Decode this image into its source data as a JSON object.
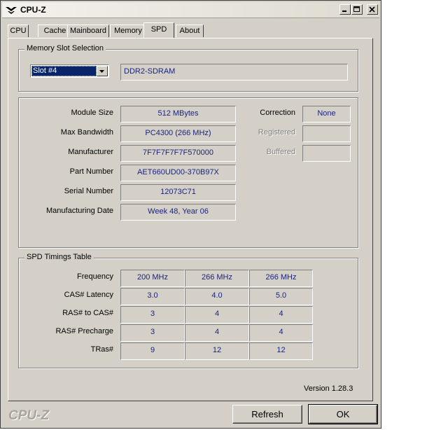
{
  "window": {
    "title": "CPU-Z"
  },
  "tabs": [
    {
      "label": "CPU",
      "active": false
    },
    {
      "label": "Cache",
      "active": false
    },
    {
      "label": "Mainboard",
      "active": false
    },
    {
      "label": "Memory",
      "active": false
    },
    {
      "label": "SPD",
      "active": true
    },
    {
      "label": "About",
      "active": false
    }
  ],
  "slot_selection": {
    "title": "Memory Slot Selection",
    "selected": "Slot #4",
    "memory_type": "DDR2-SDRAM"
  },
  "module": {
    "rows": [
      {
        "label": "Module Size",
        "value": "512 MBytes"
      },
      {
        "label": "Max Bandwidth",
        "value": "PC4300 (266 MHz)"
      },
      {
        "label": "Manufacturer",
        "value": "7F7F7F7F7F570000"
      },
      {
        "label": "Part Number",
        "value": "AET660UD00-370B97X"
      },
      {
        "label": "Serial Number",
        "value": "12073C71"
      },
      {
        "label": "Manufacturing Date",
        "value": "Week 48, Year 06"
      }
    ],
    "side": [
      {
        "label": "Correction",
        "value": "None",
        "enabled": true
      },
      {
        "label": "Registered",
        "value": "",
        "enabled": false
      },
      {
        "label": "Buffered",
        "value": "",
        "enabled": false
      }
    ]
  },
  "timings": {
    "title": "SPD Timings Table",
    "rows": [
      {
        "label": "Frequency",
        "values": [
          "200 MHz",
          "266 MHz",
          "266 MHz"
        ]
      },
      {
        "label": "CAS# Latency",
        "values": [
          "3.0",
          "4.0",
          "5.0"
        ]
      },
      {
        "label": "RAS# to CAS#",
        "values": [
          "3",
          "4",
          "4"
        ]
      },
      {
        "label": "RAS# Precharge",
        "values": [
          "3",
          "4",
          "4"
        ]
      },
      {
        "label": "TRas#",
        "values": [
          "9",
          "12",
          "12"
        ]
      }
    ]
  },
  "footer": {
    "version": "Version 1.28.3",
    "brand": "CPU-Z",
    "refresh_label": "Refresh",
    "ok_label": "OK"
  }
}
